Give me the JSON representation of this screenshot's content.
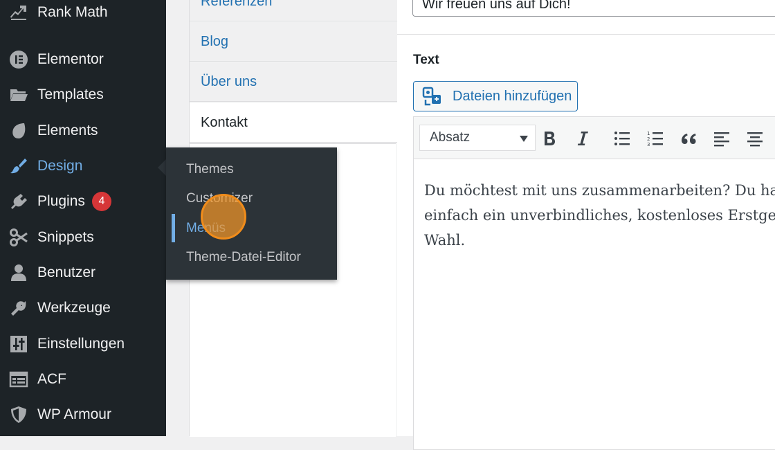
{
  "sidebar": {
    "items": [
      {
        "label": "Rank Math",
        "icon": "rank-math-icon"
      },
      {
        "label": "Elementor",
        "icon": "elementor-icon"
      },
      {
        "label": "Templates",
        "icon": "folder-icon"
      },
      {
        "label": "Elements",
        "icon": "leaf-icon"
      },
      {
        "label": "Design",
        "icon": "paintbrush-icon",
        "current": true
      },
      {
        "label": "Plugins",
        "icon": "plugin-icon",
        "badge": "4"
      },
      {
        "label": "Snippets",
        "icon": "scissors-icon"
      },
      {
        "label": "Benutzer",
        "icon": "user-icon"
      },
      {
        "label": "Werkzeuge",
        "icon": "wrench-icon"
      },
      {
        "label": "Einstellungen",
        "icon": "sliders-icon"
      },
      {
        "label": "ACF",
        "icon": "table-icon"
      },
      {
        "label": "WP Armour",
        "icon": "shield-icon"
      }
    ]
  },
  "flyout": {
    "items": [
      {
        "label": "Themes"
      },
      {
        "label": "Customizer"
      },
      {
        "label": "Menüs",
        "current": true
      },
      {
        "label": "Theme-Datei-Editor"
      }
    ]
  },
  "page_list": {
    "items": [
      {
        "label": "Referenzen"
      },
      {
        "label": "Blog"
      },
      {
        "label": "Über uns"
      },
      {
        "label": "Kontakt",
        "active": true
      }
    ]
  },
  "editor": {
    "title_value": "Wir freuen uns auf Dich!",
    "field_label": "Text",
    "media_button_label": "Dateien hinzufügen",
    "format_select_value": "Absatz",
    "content_lines": [
      "Du möchtest mit uns zusammenarbeiten? Du ha",
      "einfach ein unverbindliches, kostenloses Erstges",
      "Wahl."
    ]
  },
  "colors": {
    "sidebar_bg": "#1d2327",
    "flyout_bg": "#2c3338",
    "accent": "#72aee6",
    "link": "#2271b1",
    "badge": "#d63638",
    "click_indicator": "#f08c1b"
  }
}
